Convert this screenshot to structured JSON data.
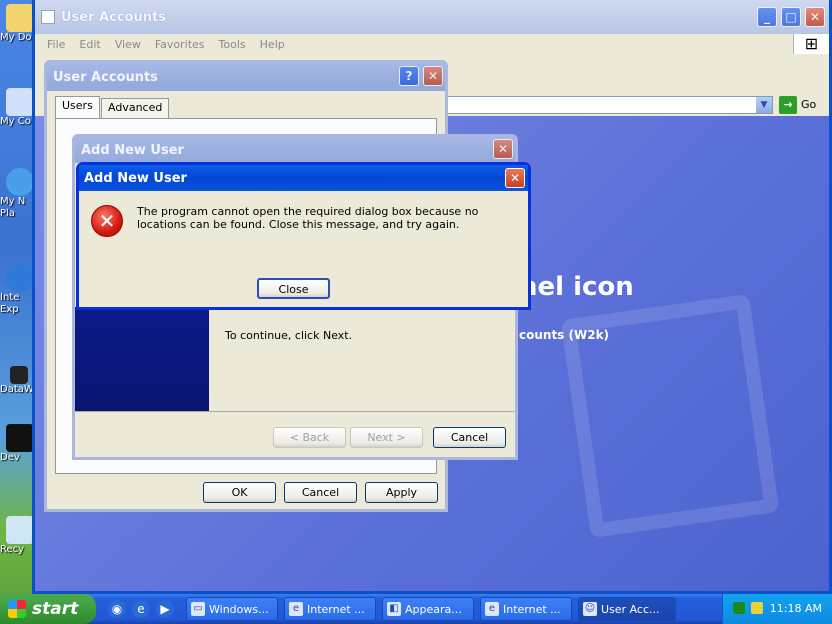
{
  "desktop": {
    "icons": [
      {
        "label": "My Do",
        "icon": "folder-icon"
      },
      {
        "label": "My Co",
        "icon": "computer-icon"
      },
      {
        "label": "My N Pla",
        "icon": "network-icon"
      },
      {
        "label": "Inte Exp",
        "icon": "ie-icon"
      },
      {
        "label": "DataW",
        "icon": "shortcut-icon"
      },
      {
        "label": "Dev",
        "icon": "shortcut-icon"
      },
      {
        "label": "Recy",
        "icon": "recycle-bin-icon"
      }
    ]
  },
  "explorer": {
    "title": "User Accounts",
    "menu": [
      "File",
      "Edit",
      "View",
      "Favorites",
      "Tools",
      "Help"
    ],
    "go_label": "Go",
    "heading": "nel icon",
    "subheading": "counts (W2k)"
  },
  "user_accounts": {
    "title": "User Accounts",
    "help_glyph": "?",
    "tabs": [
      "Users",
      "Advanced"
    ],
    "buttons": {
      "ok": "OK",
      "cancel": "Cancel",
      "apply": "Apply"
    }
  },
  "wizard": {
    "title": "Add New User",
    "body_text": "To continue, click Next.",
    "buttons": {
      "back": "< Back",
      "next": "Next >",
      "cancel": "Cancel"
    }
  },
  "error_dialog": {
    "title": "Add New User",
    "message": "The program cannot open the required dialog box because no locations can be found. Close this message, and try again.",
    "close_label": "Close"
  },
  "taskbar": {
    "start_label": "start",
    "tasks": [
      {
        "label": "Windows...",
        "icon": "window-icon"
      },
      {
        "label": "Internet ...",
        "icon": "ie-icon"
      },
      {
        "label": "Appeara...",
        "icon": "display-icon"
      },
      {
        "label": "Internet ...",
        "icon": "ie-icon"
      },
      {
        "label": "User Acc...",
        "icon": "users-icon"
      }
    ],
    "clock": "11:18 AM"
  },
  "colors": {
    "xp_blue": "#0831d9",
    "error_red": "#d21a0e",
    "start_green": "#3c9c3c"
  }
}
